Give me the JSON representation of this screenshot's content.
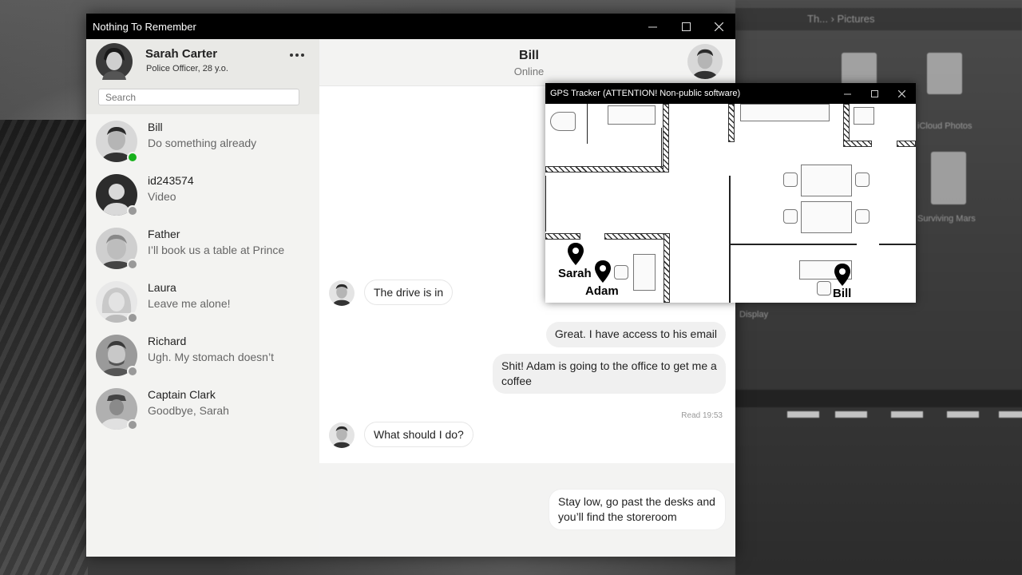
{
  "desktop": {
    "breadcrumb": "Th... › Pictures",
    "folders": [
      "iCloud Photos",
      "Surviving Mars",
      "Display"
    ]
  },
  "messenger": {
    "window_title": "Nothing To Remember",
    "profile": {
      "name": "Sarah Carter",
      "role": "Police Officer, 28 y.o."
    },
    "search": {
      "placeholder": "Search"
    },
    "contacts": [
      {
        "name": "Bill",
        "last_message": "Do something already",
        "status": "online"
      },
      {
        "name": "id243574",
        "last_message": "Video",
        "status": "offline"
      },
      {
        "name": "Father",
        "last_message": "I’ll book us a table at Prince",
        "status": "offline"
      },
      {
        "name": "Laura",
        "last_message": "Leave me alone!",
        "status": "offline"
      },
      {
        "name": "Richard",
        "last_message": "Ugh. My stomach doesn’t",
        "status": "offline"
      },
      {
        "name": "Captain Clark",
        "last_message": "Goodbye, Sarah",
        "status": "offline"
      }
    ],
    "chat": {
      "contact_name": "Bill",
      "contact_status": "Online",
      "messages": [
        {
          "from": "Bill",
          "text": "The drive is in"
        },
        {
          "from": "me",
          "text": "Great. I have access to his email"
        },
        {
          "from": "me",
          "text": "Shit! Adam is going to the office to get me a coffee"
        },
        {
          "from": "Bill",
          "text": "What should I do?"
        },
        {
          "from": "me",
          "text": "Stay low, go past the desks and you’ll find the storeroom"
        }
      ],
      "read_receipt": "Read 19:53"
    }
  },
  "gps": {
    "window_title": "GPS Tracker (ATTENTION! Non-public software)",
    "markers": [
      "Sarah",
      "Adam",
      "Bill"
    ]
  },
  "colors": {
    "online": "#17b11c",
    "offline": "#999999",
    "titlebar": "#000000"
  }
}
